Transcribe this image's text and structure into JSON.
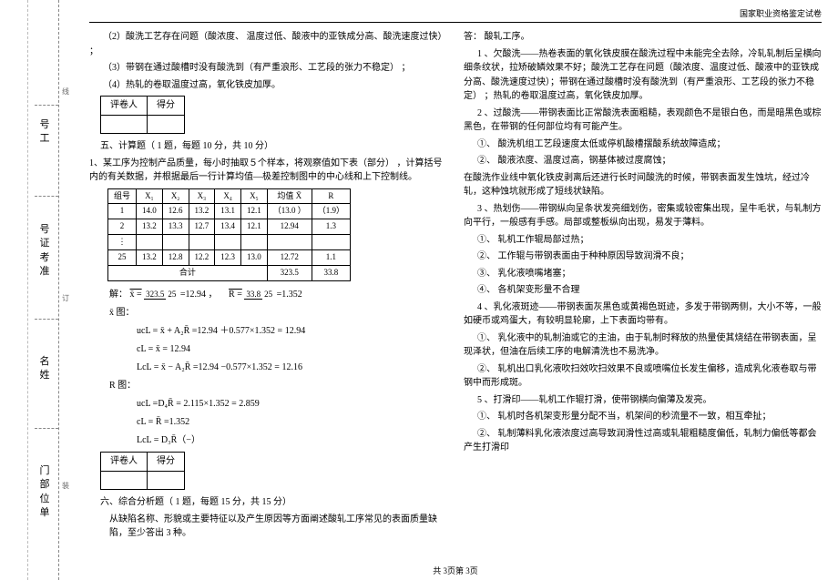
{
  "header": {
    "title": "国家职业资格鉴定试卷"
  },
  "binding": {
    "labels1": [
      "号工",
      "号证考准",
      "名姓",
      "门部位单"
    ],
    "marks": [
      "线",
      "订",
      "装"
    ]
  },
  "left": {
    "pre_lines": [
      "（2）酸洗工艺存在问题（酸浓度、 温度过低、酸液中的亚铁成分高、酸洗速度过快）  ；",
      "（3）带钢在通过酸槽时没有酸洗到（有严重浪形、工艺段的张力不稳定）     ；",
      "（4）热轧的卷取温度过高，氧化铁皮加厚。"
    ],
    "score1": {
      "h1": "评卷人",
      "h2": "得分"
    },
    "sec5_h": "五、计算题（ 1 题，每题  10 分，共  10 分）",
    "q1": "1、某工序为控制产品质量，每小时抽取５个样本，将观察值如下表（部分）     ，计算括号内的有关数据，并根据最后一行计算均值—极差控制图中的中心线和上下控制线。",
    "table": {
      "head": [
        "组号",
        "X₁",
        "X₂",
        "X₃",
        "X₄",
        "X₅",
        "均值 X̄",
        "R"
      ],
      "rows": [
        [
          "1",
          "14.0",
          "12.6",
          "13.2",
          "13.1",
          "12.1",
          "（13.0 ）",
          "（1.9）"
        ],
        [
          "2",
          "13.2",
          "13.3",
          "12.7",
          "13.4",
          "12.1",
          "12.94",
          "1.3"
        ],
        [
          "⋮",
          "",
          "",
          "",
          "",
          "",
          "",
          ""
        ],
        [
          "25",
          "13.2",
          "12.8",
          "12.2",
          "12.3",
          "13.0",
          "12.72",
          "1.1"
        ]
      ],
      "sum_label": "合计",
      "sum_mean": "323.5",
      "sum_r": "33.8"
    },
    "calc": {
      "solve": "解：",
      "xbar_eq_pre": "x̄ =",
      "xbar_num": "323.5",
      "xbar_den": "25",
      "xbar_val": "=12.94 ，",
      "rbar_eq_pre": "R̄ =",
      "rbar_num": "33.8",
      "rbar_den": "25",
      "rbar_val": "=1.352",
      "xchart": "x̄ 图：",
      "x_ucl": "ucL = x̄ + A₂R̄ =12.94 ＋0.577×1.352 = 12.94",
      "x_cl": "cL = x̄ = 12.94",
      "x_lcl": "LcL = x̄ − A₂R̄ =12.94 −0.577×1.352 = 12.16",
      "rchart": "R  图：",
      "r_ucl": "ucL =D₄R̄ = 2.115×1.352 = 2.859",
      "r_cl": "cL = R̄ =1.352",
      "r_lcl": "LcL = D₃R̄（−）"
    },
    "score2": {
      "h1": "评卷人",
      "h2": "得分"
    },
    "sec6_h": "六、综合分析题（ 1 题，每题  15 分，共  15 分）",
    "q6": "从缺陷名称、形貌或主要特征以及产生原因等方面阐述酸轧工序常见的表面质量缺陷，至少答出  3 种。"
  },
  "right": {
    "ans_h": "答：  酸轧工序。",
    "p1a": "1 、欠酸洗——热卷表面的氧化铁皮膜在酸洗过程中未能完全去除，冷轧轧制后呈横向细条纹状，拉矫破鳞效果不好；酸洗工艺存在问题（酸浓度、温度过低、酸液中的亚铁成分高、酸洗速度过快）；带钢在通过酸槽时没有酸洗到（有严重浪形、工艺段的张力不稳定）        ；热轧的卷取温度过高，氧化铁皮加厚。",
    "p2a": "2 、过酸洗——带钢表面比正常酸洗表面粗糙，表观颜色不是银白色，而是暗黑色或棕黑色，在带钢的任何部位均有可能产生。",
    "p2b": "①、    酸洗机组工艺段速度太低或停机酸槽摆酸系统故障造成；",
    "p2c": "②、    酸液浓度、温度过高，钢基体被过度腐蚀；",
    "p3": "在酸洗作业线中氧化铁皮剥离后还进行长时间酸洗的时候，带钢表面发生蚀坑，经过冷轧，这种蚀坑就形成了短线状缺陷。",
    "p4a": "3 、热划伤——带钢纵向呈条状发亮细划伤，密集或较密集出现，呈牛毛状，与轧制方向平行，一般感有手感。局部或整板纵向出现，易发于薄料。",
    "p4b": "①、    轧机工作辊局部过热；",
    "p4c": "②、    工作辊与带钢表面由于种种原因导致润滑不良；",
    "p4d": "③、    乳化液喷嘴堵塞；",
    "p4e": "④、    各机架变形量不合理",
    "p5a": "4 、乳化液斑迹——带钢表面灰黑色或黄褐色斑迹，多发于带钢两侧，大小不等，一般如硬币或鸡蛋大，有较明显轮廓，上下表面均带有。",
    "p5b": "①、    乳化液中的轧制油或它的主油，由于轧制时释放的热量使其烧结在带钢表面，呈现泽状，但油在后续工序的电解清洗也不易洗净。",
    "p5c": "②、    轧机出口乳化液吹扫效吹扫效果不良或喷嘴位长发生偏移，造成乳化液卷取与带钢中而形成斑。",
    "p6a": "5 、打滑印——轧机工作辊打滑，使带钢横向偏薄及发亮。",
    "p6b": "①、    轧机时各机架变形量分配不当，机架间的秒流量不一致，相互牵扯；",
    "p6c": "②、    轧制薄料乳化液浓度过高导致润滑性过高或轧辊粗糙度偏低，轧制力偏低等都会产生打滑印"
  },
  "footer": {
    "text": "共 3页第 3页"
  }
}
